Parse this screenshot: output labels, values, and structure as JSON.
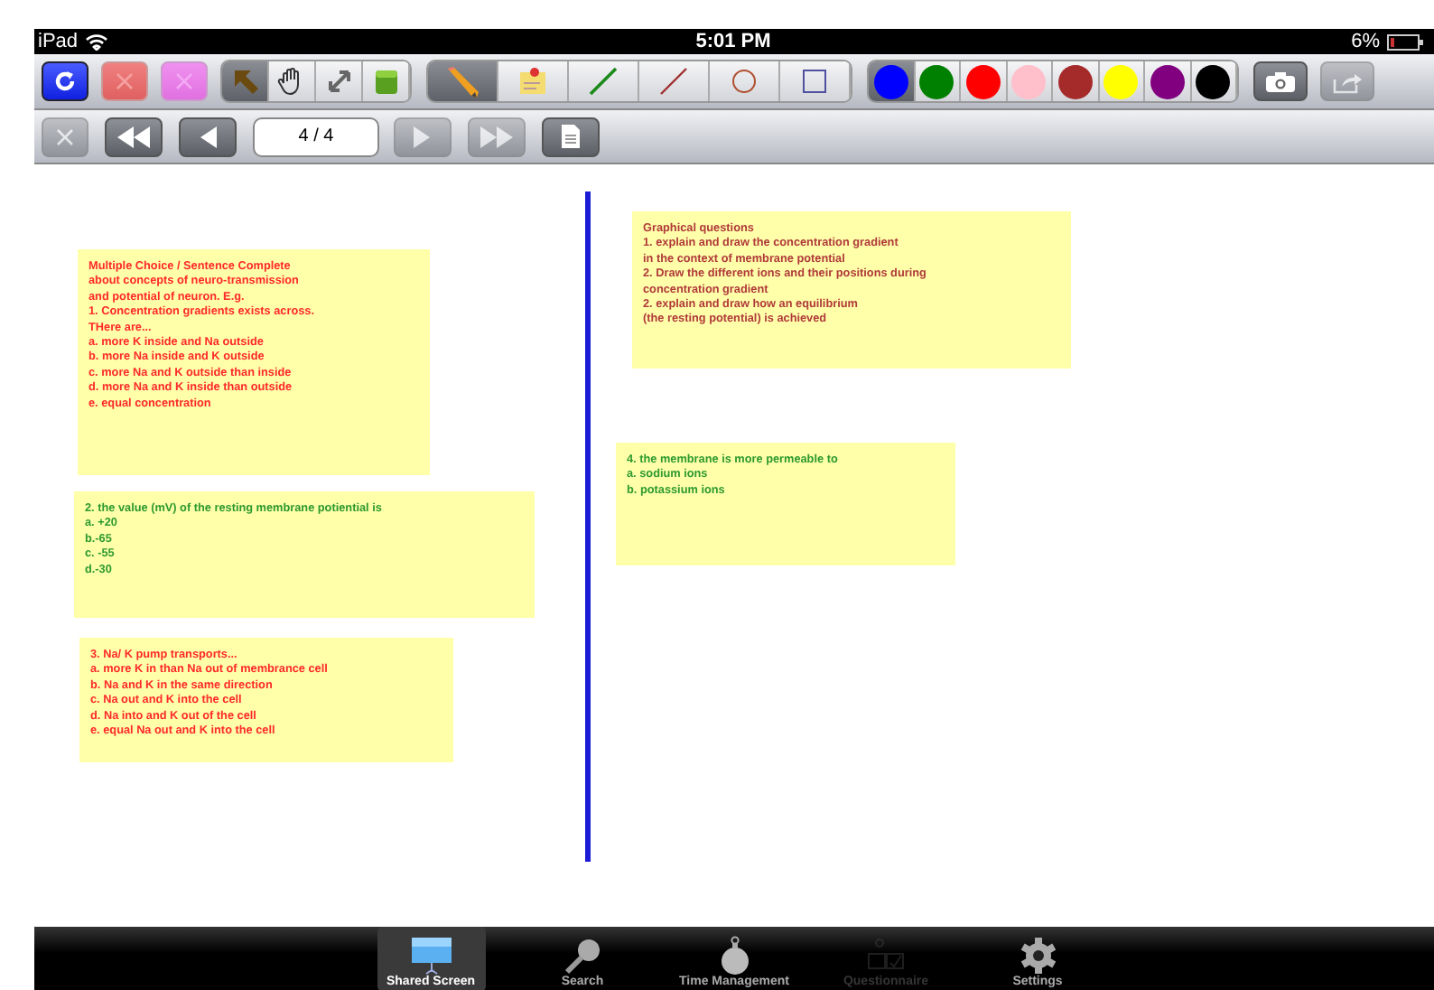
{
  "status_bar": {
    "device": "iPad",
    "time": "5:01 PM",
    "battery": "6%"
  },
  "toolbar": {
    "actions": [
      {
        "kind": "refresh",
        "disabled": false
      },
      {
        "kind": "clear-red",
        "disabled": false
      },
      {
        "kind": "clear-pink",
        "disabled": false
      }
    ],
    "select_tools": [
      {
        "kind": "arrow",
        "selected": true
      },
      {
        "kind": "hand",
        "selected": false
      },
      {
        "kind": "resize",
        "selected": false
      },
      {
        "kind": "box",
        "selected": false
      }
    ],
    "draw_tools": [
      {
        "kind": "pencil",
        "selected": true
      },
      {
        "kind": "note",
        "selected": false
      },
      {
        "kind": "line-green",
        "selected": false
      },
      {
        "kind": "line-red",
        "selected": false
      },
      {
        "kind": "circle",
        "selected": false
      },
      {
        "kind": "square",
        "selected": false
      }
    ],
    "colors": [
      {
        "color": "#0000ff",
        "selected": true
      },
      {
        "color": "#008000",
        "selected": false
      },
      {
        "color": "#ff0000",
        "selected": false
      },
      {
        "color": "#ffc0cb",
        "selected": false
      },
      {
        "color": "#a52a2a",
        "selected": false
      },
      {
        "color": "#ffff00",
        "selected": false
      },
      {
        "color": "#800080",
        "selected": false
      },
      {
        "color": "#000000",
        "selected": false
      }
    ],
    "extras": [
      {
        "kind": "camera",
        "disabled": false
      },
      {
        "kind": "share",
        "disabled": true
      }
    ]
  },
  "navbar": {
    "buttons_left": [
      {
        "kind": "close",
        "disabled": true
      },
      {
        "kind": "first",
        "disabled": false
      },
      {
        "kind": "prev",
        "disabled": false
      }
    ],
    "page": "4 / 4",
    "buttons_right": [
      {
        "kind": "next",
        "disabled": true
      },
      {
        "kind": "last",
        "disabled": true
      },
      {
        "kind": "document",
        "disabled": false
      }
    ]
  },
  "notes": [
    {
      "color": "#ff2a2a",
      "lines": [
        "Multiple Choice / Sentence Complete",
        "about concepts of neuro-transmission",
        "and potential of neuron. E.g.",
        "1. Concentration gradients exists across.",
        "THere are...",
        "a. more K inside and Na outside",
        "b. more Na inside and K outside",
        "c. more Na and K outside than inside",
        "d. more Na and K inside than outside",
        "e. equal concentration"
      ]
    },
    {
      "color": "#2e9a2e",
      "lines": [
        "2. the value (mV) of the resting membrane potiential is",
        "a. +20",
        "b.-65",
        "c. -55",
        "d.-30"
      ]
    },
    {
      "color": "#ff2a2a",
      "lines": [
        "3. Na/ K pump transports...",
        "a. more K in than Na out of membrance cell",
        "b. Na and K in the same direction",
        "c. Na out and K into the cell",
        "d. Na into and K out of the cell",
        "e. equal Na out and K into the cell"
      ]
    },
    {
      "color": "#b03a3a",
      "lines": [
        "Graphical questions",
        "1. explain and draw the concentration gradient",
        "in the context of membrane potential",
        "2. Draw the different ions and their positions during",
        "concentration gradient",
        "2. explain and draw how an equilibrium",
        "(the resting potential) is achieved"
      ]
    },
    {
      "color": "#2e9a2e",
      "lines": [
        "4. the membrane is more permeable to",
        "a. sodium ions",
        "b. potassium ions"
      ]
    }
  ],
  "tab_bar": [
    {
      "label": "Shared Screen",
      "kind": "screen",
      "selected": true,
      "disabled": false
    },
    {
      "label": "Search",
      "kind": "search",
      "selected": false,
      "disabled": false
    },
    {
      "label": "Time Management",
      "kind": "timer",
      "selected": false,
      "disabled": false
    },
    {
      "label": "Questionnaire",
      "kind": "quiz",
      "selected": false,
      "disabled": true
    },
    {
      "label": "Settings",
      "kind": "settings",
      "selected": false,
      "disabled": false
    }
  ]
}
